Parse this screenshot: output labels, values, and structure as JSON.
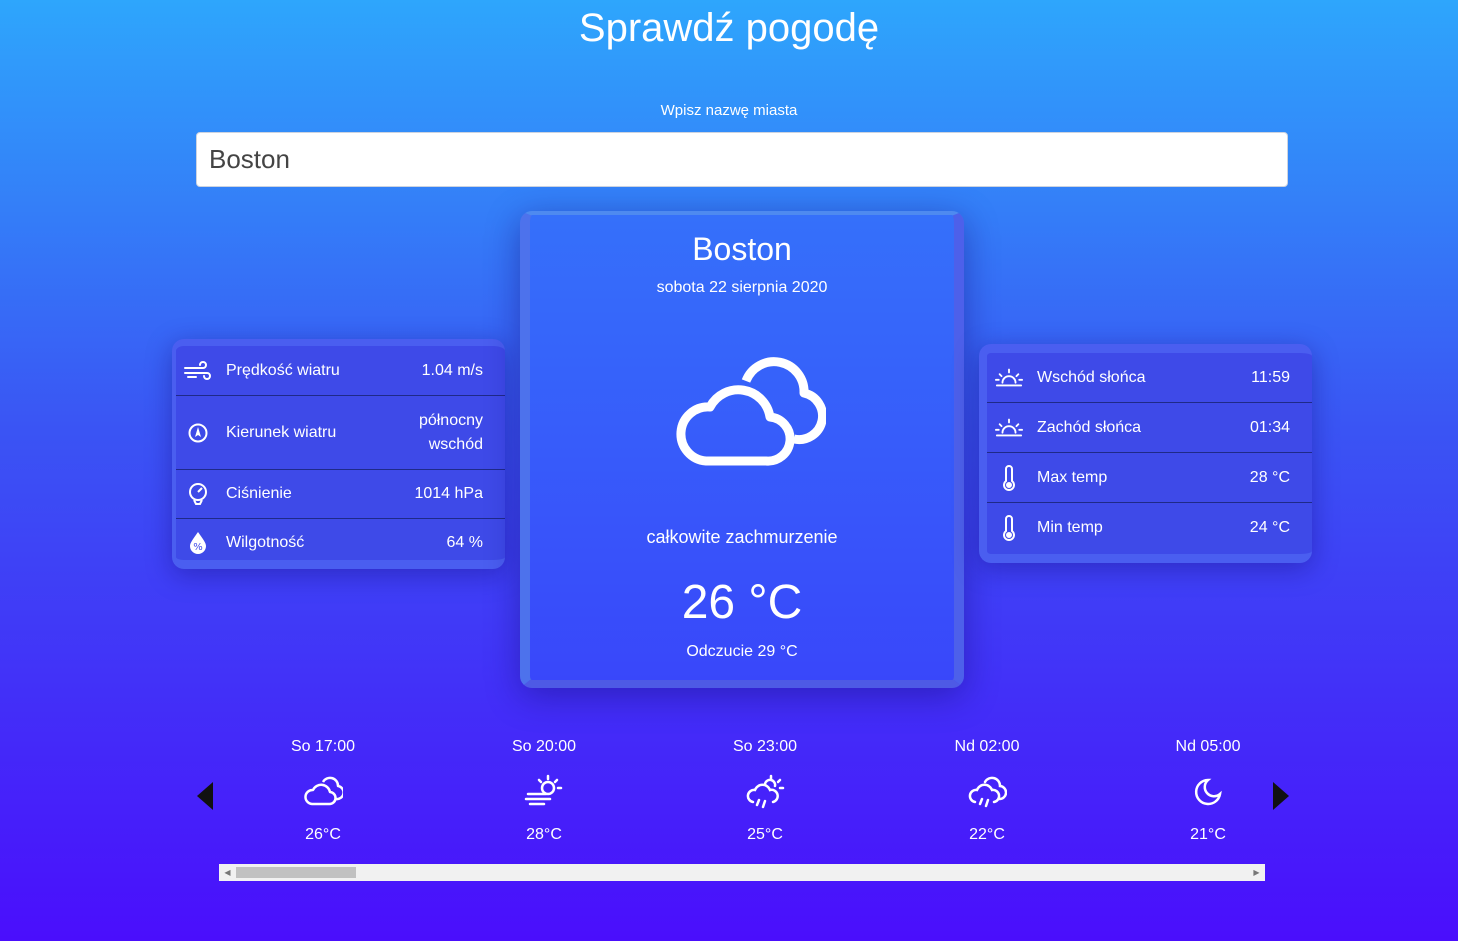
{
  "page": {
    "title": "Sprawdź pogodę"
  },
  "search": {
    "label": "Wpisz nazwę miasta",
    "value": "Boston"
  },
  "current": {
    "city": "Boston",
    "date": "sobota 22 sierpnia 2020",
    "icon": "cloud-icon",
    "description": "całkowite zachmurzenie",
    "temp": "26 °C",
    "feels_like": "Odczucie 29 °C"
  },
  "details_left": [
    {
      "icon": "wind-icon",
      "label": "Prędkość wiatru",
      "value": "1.04 m/s"
    },
    {
      "icon": "compass-icon",
      "label": "Kierunek wiatru",
      "value": "północny wschód"
    },
    {
      "icon": "gauge-icon",
      "label": "Ciśnienie",
      "value": "1014 hPa"
    },
    {
      "icon": "humidity-icon",
      "label": "Wilgotność",
      "value": "64 %"
    }
  ],
  "details_right": [
    {
      "icon": "sunrise-icon",
      "label": "Wschód słońca",
      "value": "11:59"
    },
    {
      "icon": "sunset-icon",
      "label": "Zachód słońca",
      "value": "01:34"
    },
    {
      "icon": "thermometer-icon",
      "label": "Max temp",
      "value": "28 °C"
    },
    {
      "icon": "thermometer-icon",
      "label": "Min temp",
      "value": "24 °C"
    }
  ],
  "forecast": [
    {
      "time": "So 17:00",
      "icon": "cloud-icon",
      "temp": "26°C"
    },
    {
      "time": "So 20:00",
      "icon": "sun-wind-icon",
      "temp": "28°C"
    },
    {
      "time": "So 23:00",
      "icon": "sun-rain-cloud-icon",
      "temp": "25°C"
    },
    {
      "time": "Nd 02:00",
      "icon": "rain-cloud-icon",
      "temp": "22°C"
    },
    {
      "time": "Nd 05:00",
      "icon": "moon-icon",
      "temp": "21°C"
    }
  ]
}
